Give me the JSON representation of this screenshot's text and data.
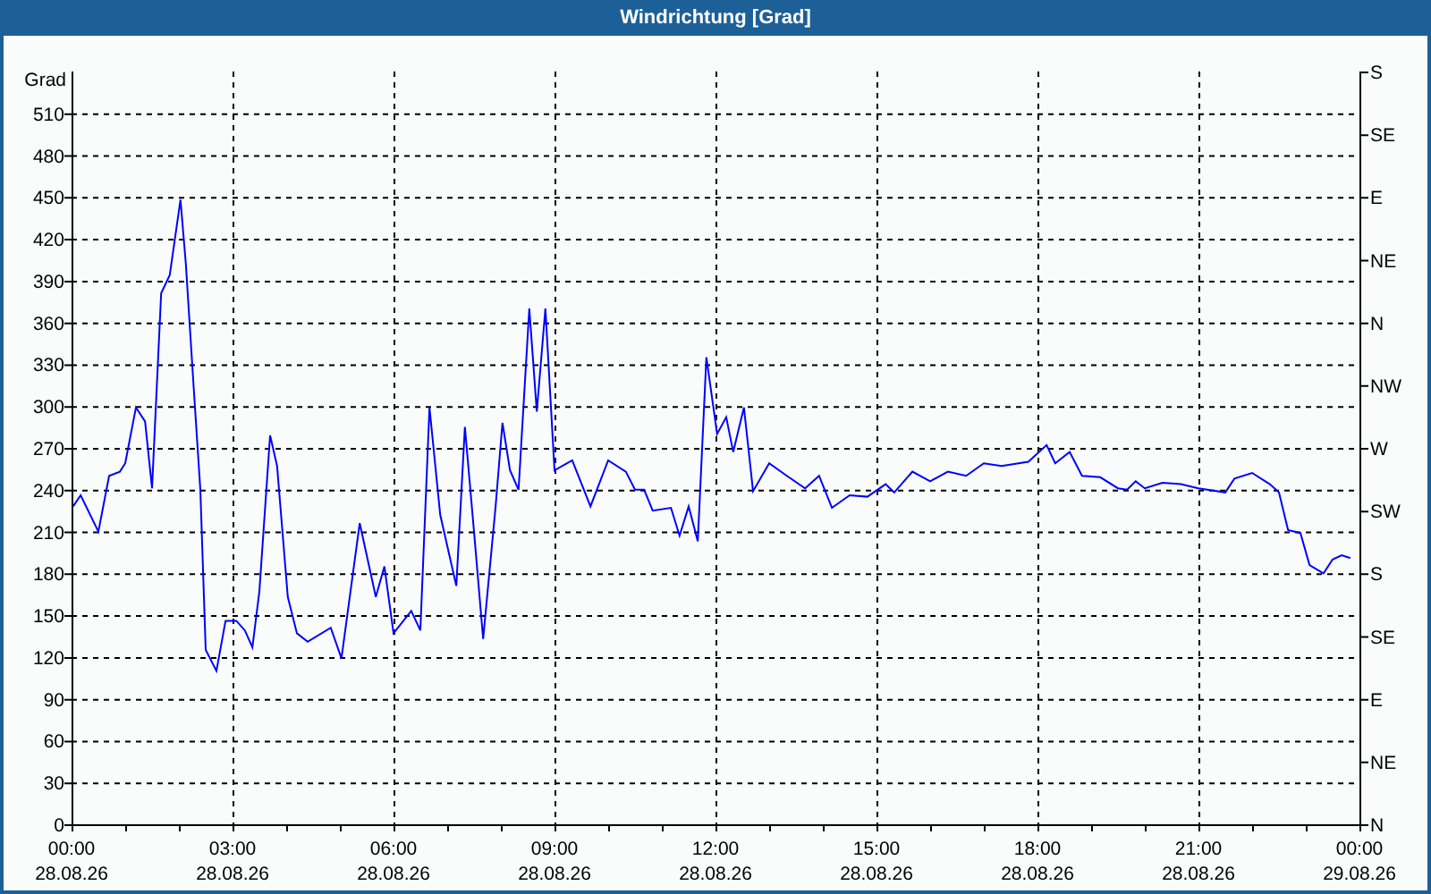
{
  "window": {
    "title": "Windrichtung [Grad]"
  },
  "chart": {
    "date_labels": [
      "28.08.26",
      "28.08.26",
      "28.08.26",
      "28.08.26",
      "28.08.26",
      "28.08.26",
      "28.08.26",
      "28.08.26",
      "29.08.26"
    ],
    "compass_axis": {
      "labels": [
        "S",
        "SE",
        "E",
        "NE",
        "N",
        "NW",
        "W",
        "SW",
        "S",
        "SE",
        "E",
        "NE",
        "N"
      ]
    },
    "chart_data": {
      "type": "line",
      "grid": true,
      "ylabel": "Grad",
      "xlim": [
        0,
        24
      ],
      "ylim": [
        0,
        540
      ],
      "xticks": [
        {
          "value": 0,
          "label": "00:00"
        },
        {
          "value": 3,
          "label": "03:00"
        },
        {
          "value": 6,
          "label": "06:00"
        },
        {
          "value": 9,
          "label": "09:00"
        },
        {
          "value": 12,
          "label": "12:00"
        },
        {
          "value": 15,
          "label": "15:00"
        },
        {
          "value": 18,
          "label": "18:00"
        },
        {
          "value": 21,
          "label": "21:00"
        },
        {
          "value": 24,
          "label": "00:00"
        }
      ],
      "yticks": [
        0,
        30,
        60,
        90,
        120,
        150,
        180,
        210,
        240,
        270,
        300,
        330,
        360,
        390,
        420,
        450,
        480,
        510
      ],
      "x": [
        0.03,
        0.17,
        0.5,
        0.7,
        0.9,
        1.0,
        1.2,
        1.37,
        1.5,
        1.67,
        1.83,
        2.03,
        2.13,
        2.27,
        2.4,
        2.5,
        2.7,
        2.87,
        3.07,
        3.23,
        3.37,
        3.5,
        3.7,
        3.83,
        4.03,
        4.2,
        4.4,
        4.83,
        5.03,
        5.37,
        5.67,
        5.83,
        6.0,
        6.33,
        6.5,
        6.67,
        6.87,
        7.17,
        7.33,
        7.5,
        7.67,
        7.9,
        8.03,
        8.17,
        8.33,
        8.53,
        8.67,
        8.83,
        9.0,
        9.33,
        9.67,
        10.0,
        10.33,
        10.5,
        10.67,
        10.83,
        11.17,
        11.33,
        11.5,
        11.67,
        11.83,
        12.03,
        12.2,
        12.33,
        12.53,
        12.7,
        13.0,
        13.33,
        13.67,
        13.93,
        14.17,
        14.5,
        14.83,
        15.17,
        15.33,
        15.67,
        16.0,
        16.33,
        16.67,
        17.0,
        17.33,
        17.83,
        18.17,
        18.33,
        18.6,
        18.83,
        19.17,
        19.5,
        19.67,
        19.83,
        20.0,
        20.33,
        20.67,
        21.0,
        21.5,
        21.67,
        22.0,
        22.33,
        22.5,
        22.67,
        22.9,
        23.07,
        23.33,
        23.5,
        23.67,
        23.83
      ],
      "series": [
        {
          "color": "#0000ff",
          "values": [
            228,
            236,
            210,
            250,
            253,
            259,
            299,
            289,
            241,
            381,
            394,
            448,
            402,
            317,
            240,
            125,
            110,
            146,
            146,
            139,
            127,
            167,
            279,
            257,
            163,
            137,
            131,
            141,
            119,
            216,
            163,
            185,
            137,
            153,
            139,
            299,
            222,
            171,
            285,
            210,
            133,
            227,
            288,
            254,
            240,
            370,
            296,
            370,
            254,
            261,
            228,
            261,
            253,
            240,
            240,
            225,
            227,
            207,
            228,
            203,
            335,
            280,
            292,
            267,
            299,
            239,
            259,
            250,
            241,
            250,
            227,
            236,
            235,
            244,
            238,
            253,
            246,
            253,
            250,
            259,
            257,
            260,
            272,
            259,
            267,
            250,
            249,
            241,
            240,
            246,
            241,
            245,
            244,
            241,
            238,
            248,
            252,
            244,
            238,
            211,
            209,
            186,
            180,
            190,
            193,
            191
          ]
        }
      ]
    }
  }
}
